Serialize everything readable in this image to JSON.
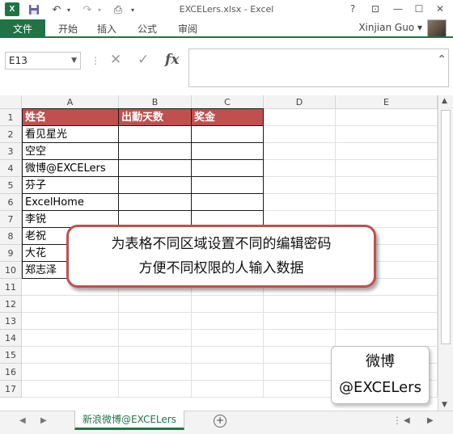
{
  "window": {
    "title": "EXCELers.xlsx - Excel",
    "help": "?",
    "ribbon_display": "⊡",
    "minimize": "—",
    "maximize": "☐",
    "close": "✕"
  },
  "qat": {
    "logo": "X",
    "save_icon": "💾",
    "undo_icon": "↶",
    "redo_icon": "↷",
    "preview_icon": "⎙",
    "more_icon": "▾"
  },
  "ribbon": {
    "file": "文件",
    "tabs": [
      "开始",
      "插入",
      "公式",
      "审阅"
    ],
    "user": "Xinjian Guo ▾"
  },
  "formula_bar": {
    "name_box": "E13",
    "cancel": "✕",
    "enter": "✓",
    "fx": "fx",
    "formula": "",
    "collapse": "⌃"
  },
  "grid": {
    "columns": [
      "A",
      "B",
      "C",
      "D",
      "E"
    ],
    "rows": [
      "1",
      "2",
      "3",
      "4",
      "5",
      "6",
      "7",
      "8",
      "9",
      "10",
      "11",
      "12",
      "13",
      "14",
      "15",
      "16",
      "17"
    ],
    "header_row": [
      "姓名",
      "出勤天数",
      "奖金"
    ],
    "names": [
      "看见星光",
      "空空",
      "微博@EXCELers",
      "芬子",
      "ExcelHome",
      "李锐",
      "老祝",
      "大花",
      "郑志泽"
    ]
  },
  "callout": {
    "line1": "为表格不同区域设置不同的编辑密码",
    "line2": "方便不同权限的人输入数据"
  },
  "weibo_box": {
    "line1": "微博",
    "line2": "@EXCELers"
  },
  "sheets": {
    "nav_prev": "◀",
    "nav_next": "▶",
    "active": "新浪微博@EXCELers",
    "add": "+"
  },
  "colors": {
    "excel_green": "#217346",
    "header_red": "#c0504d"
  }
}
